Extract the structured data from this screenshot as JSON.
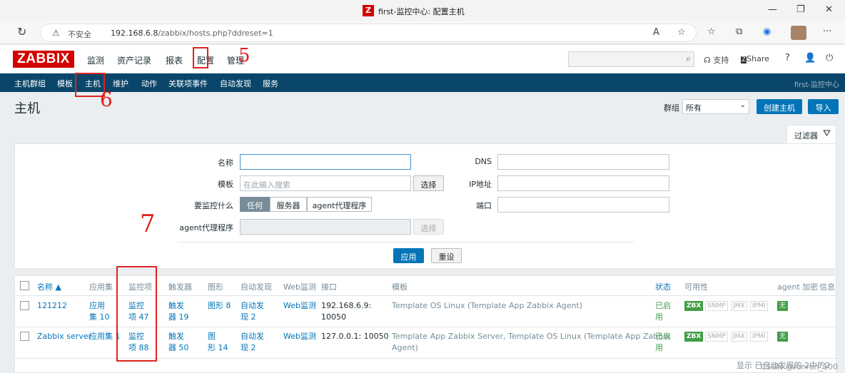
{
  "browser": {
    "tab_title": "first-监控中心: 配置主机",
    "tab_icon": "Z",
    "insecure": "不安全",
    "url_host": "192.168.6.8",
    "url_path": "/zabbix/hosts.php?ddreset=1"
  },
  "header": {
    "logo": "ZABBIX",
    "menu": [
      "监测",
      "资产记录",
      "报表",
      "配置",
      "管理"
    ],
    "support": "支持",
    "share": "Share",
    "help": "?"
  },
  "subnav": {
    "items": [
      "主机群组",
      "模板",
      "主机",
      "维护",
      "动作",
      "关联项事件",
      "自动发现",
      "服务"
    ],
    "server": "first-监控中心"
  },
  "page": {
    "title": "主机",
    "group_label": "群组",
    "group_value": "所有",
    "create_host": "创建主机",
    "import": "导入"
  },
  "filter": {
    "tab_label": "过滤器",
    "name_label": "名称",
    "template_label": "模板",
    "template_placeholder": "在此输入搜索",
    "select_btn": "选择",
    "monitored_by_label": "要监控什么",
    "monitored_by_options": [
      "任何",
      "服务器",
      "agent代理程序"
    ],
    "proxy_label": "agent代理程序",
    "proxy_select": "选择",
    "dns_label": "DNS",
    "ip_label": "IP地址",
    "port_label": "端口",
    "apply": "应用",
    "reset": "重设"
  },
  "table": {
    "headers": [
      "名称 ▲",
      "应用集",
      "监控项",
      "触发器",
      "图形",
      "自动发现",
      "Web监测",
      "接口",
      "模板",
      "状态",
      "可用性",
      "agent 加密",
      "信息"
    ],
    "rows": [
      {
        "name": "121212",
        "apps": [
          "应用",
          "集 10"
        ],
        "items": [
          "监控",
          "项 47"
        ],
        "triggers": [
          "触发",
          "器 19"
        ],
        "graphs": "图形 8",
        "discovery": [
          "自动发",
          "现 2"
        ],
        "web": "Web监测",
        "iface": [
          "192.168.6.9:",
          "10050"
        ],
        "templates": [
          "Template OS Linux (Template App Zabbix Agent)"
        ],
        "status": [
          "已启",
          "用"
        ],
        "avail": [
          "ZBX",
          "SNMP",
          "JMX",
          "IPMI"
        ],
        "enc": "无"
      },
      {
        "name": "Zabbix server",
        "apps": [
          "应用集 1"
        ],
        "items": [
          "监控",
          "项 88"
        ],
        "triggers": [
          "触发",
          "器 50"
        ],
        "graphs": [
          "图",
          "形 14"
        ],
        "discovery": [
          "自动发",
          "现 2"
        ],
        "web": "Web监测",
        "iface": [
          "127.0.0.1: 10050"
        ],
        "templates": [
          "Template App Zabbix Server, Template OS Linux (Template App Zabbix",
          "Agent)"
        ],
        "status": [
          "已启",
          "用"
        ],
        "avail": [
          "ZBX",
          "SNMP",
          "JMX",
          "IPMI"
        ],
        "enc": "无"
      }
    ],
    "footer": "显示 已自动发现的 2中的2"
  },
  "annotations": [
    "5",
    "6",
    "7"
  ],
  "watermark": "CSDN @renren_100"
}
